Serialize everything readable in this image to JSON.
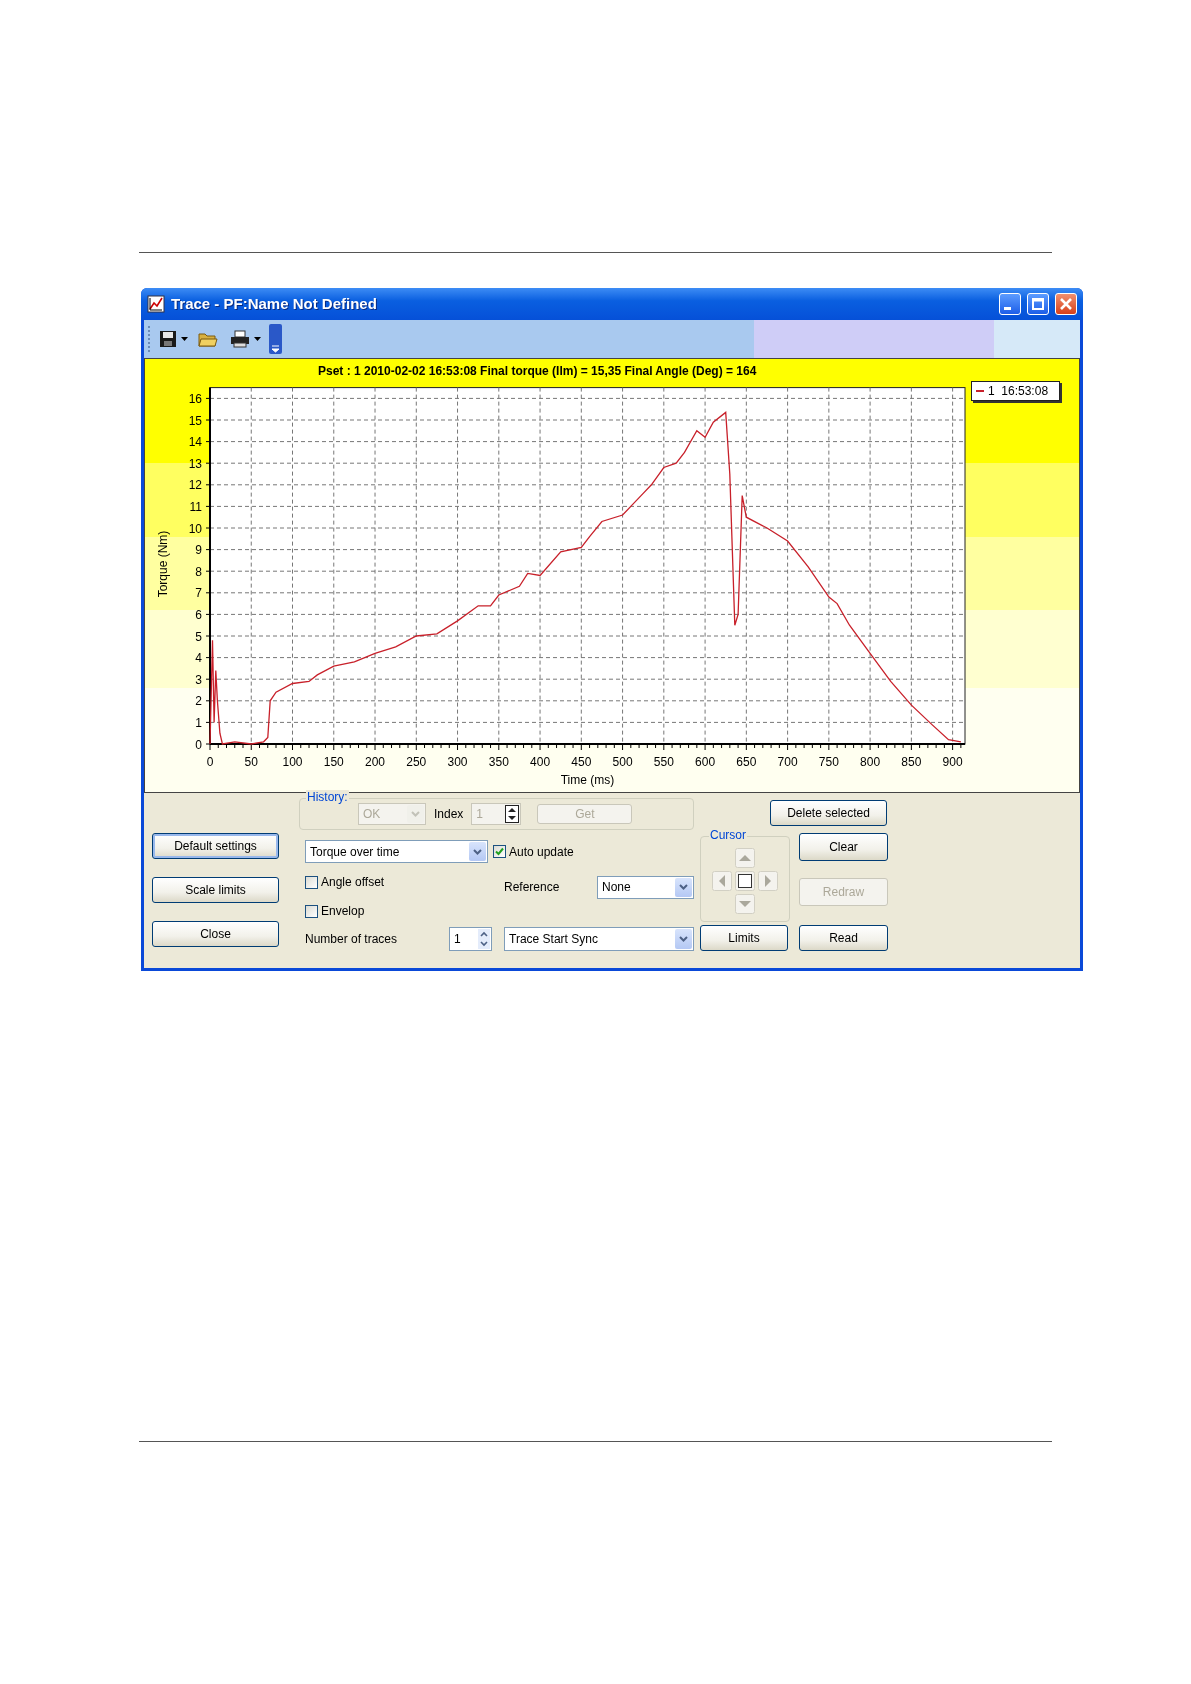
{
  "window": {
    "title": "Trace - PF:Name Not Defined"
  },
  "chart": {
    "chart_data": {
      "type": "line",
      "title": "Pset : 1  2010-02-02  16:53:08  Final torque (Ilm) = 15,35 Final Angle (Deg) = 164",
      "xlabel": "Time (ms)",
      "ylabel": "Torque (Nm)",
      "x": [
        0,
        3,
        5,
        7,
        9,
        12,
        15,
        30,
        50,
        65,
        70,
        73,
        80,
        100,
        120,
        130,
        150,
        175,
        200,
        225,
        250,
        275,
        300,
        325,
        340,
        350,
        375,
        385,
        400,
        425,
        450,
        460,
        475,
        500,
        510,
        525,
        535,
        550,
        565,
        575,
        590,
        600,
        610,
        625,
        630,
        636,
        640,
        645,
        650,
        675,
        700,
        725,
        750,
        760,
        775,
        800,
        825,
        850,
        875,
        895,
        910
      ],
      "series": [
        {
          "name": "1  16:53:08",
          "color": "#c8202a",
          "values": [
            0,
            4.8,
            1,
            3.4,
            2,
            0.5,
            0,
            0.1,
            0,
            0.1,
            0.3,
            2,
            2.4,
            2.8,
            2.9,
            3.2,
            3.6,
            3.8,
            4.2,
            4.5,
            5,
            5.1,
            5.7,
            6.4,
            6.4,
            6.9,
            7.3,
            7.9,
            7.8,
            8.9,
            9.1,
            9.6,
            10.3,
            10.6,
            11,
            11.6,
            12,
            12.8,
            13,
            13.5,
            14.5,
            14.2,
            14.9,
            15.35,
            12.5,
            5.5,
            6,
            11.5,
            10.5,
            10,
            9.4,
            8.2,
            6.8,
            6.5,
            5.5,
            4.2,
            2.9,
            1.8,
            0.9,
            0.2,
            0.1
          ]
        }
      ],
      "xlim": [
        0,
        915
      ],
      "ylim": [
        0,
        16.5
      ],
      "xticks": [
        0,
        50,
        100,
        150,
        200,
        250,
        300,
        350,
        400,
        450,
        500,
        550,
        600,
        650,
        700,
        750,
        800,
        850,
        900
      ],
      "yticks": [
        0,
        1,
        2,
        3,
        4,
        5,
        6,
        7,
        8,
        9,
        10,
        11,
        12,
        13,
        14,
        15,
        16
      ],
      "grid": true
    }
  },
  "controls": {
    "left_buttons": [
      {
        "label": "Default settings",
        "focused": true
      },
      {
        "label": "Scale limits",
        "focused": false
      },
      {
        "label": "Close",
        "focused": false
      }
    ],
    "history": {
      "label": "History:",
      "result": {
        "value": "OK",
        "disabled": true
      },
      "index_label": "Index",
      "index": {
        "value": "1",
        "disabled": true
      },
      "get_button": {
        "label": "Get",
        "disabled": true
      }
    },
    "view": {
      "value": "Torque over time"
    },
    "auto_update": {
      "label": "Auto update",
      "checked": true
    },
    "angle_offset": {
      "label": "Angle offset",
      "checked": false
    },
    "envelop": {
      "label": "Envelop",
      "checked": false
    },
    "reference": {
      "label": "Reference",
      "value": "None"
    },
    "traces": {
      "label": "Number of traces",
      "value": "1"
    },
    "sync": {
      "value": "Trace Start Sync"
    },
    "cursor": {
      "label": "Cursor"
    },
    "right_buttons": [
      {
        "label": "Delete selected",
        "disabled": false
      },
      {
        "label": "Clear",
        "disabled": false
      },
      {
        "label": "Redraw",
        "disabled": true
      },
      {
        "label": "Limits",
        "disabled": false
      },
      {
        "label": "Read",
        "disabled": false
      }
    ]
  }
}
